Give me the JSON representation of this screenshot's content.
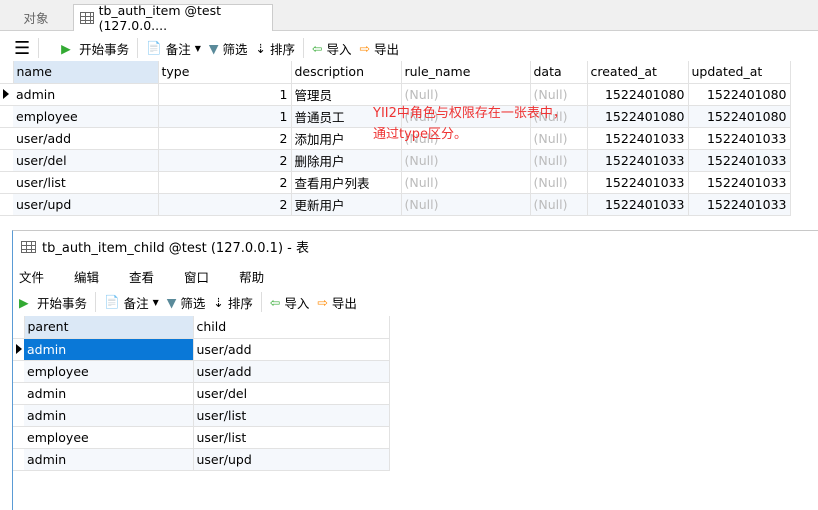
{
  "tabs": [
    {
      "label": "对象"
    },
    {
      "label": "tb_auth_item @test (127.0.0...."
    }
  ],
  "toolbar": {
    "begin_transaction": "开始事务",
    "note": "备注",
    "filter": "筛选",
    "sort": "排序",
    "import": "导入",
    "export": "导出"
  },
  "auth_item": {
    "columns": [
      "name",
      "type",
      "description",
      "rule_name",
      "data",
      "created_at",
      "updated_at"
    ],
    "rows": [
      [
        "admin",
        "1",
        "管理员",
        "(Null)",
        "(Null)",
        "1522401080",
        "1522401080"
      ],
      [
        "employee",
        "1",
        "普通员工",
        "(Null)",
        "(Null)",
        "1522401080",
        "1522401080"
      ],
      [
        "user/add",
        "2",
        "添加用户",
        "(Null)",
        "(Null)",
        "1522401033",
        "1522401033"
      ],
      [
        "user/del",
        "2",
        "删除用户",
        "(Null)",
        "(Null)",
        "1522401033",
        "1522401033"
      ],
      [
        "user/list",
        "2",
        "查看用户列表",
        "(Null)",
        "(Null)",
        "1522401033",
        "1522401033"
      ],
      [
        "user/upd",
        "2",
        "更新用户",
        "(Null)",
        "(Null)",
        "1522401033",
        "1522401033"
      ]
    ]
  },
  "annotation": {
    "line1": "YII2中角色与权限存在一张表中，",
    "line2": "通过type区分。"
  },
  "child_window": {
    "title": "tb_auth_item_child @test (127.0.0.1) - 表",
    "menu": [
      "文件",
      "编辑",
      "查看",
      "窗口",
      "帮助"
    ],
    "columns": [
      "parent",
      "child"
    ],
    "rows": [
      [
        "admin",
        "user/add"
      ],
      [
        "employee",
        "user/add"
      ],
      [
        "admin",
        "user/del"
      ],
      [
        "admin",
        "user/list"
      ],
      [
        "employee",
        "user/list"
      ],
      [
        "admin",
        "user/upd"
      ]
    ]
  },
  "colors": {
    "selection": "#0a78d7",
    "annotation": "#e33333",
    "header_selected": "#dbe8f6"
  }
}
